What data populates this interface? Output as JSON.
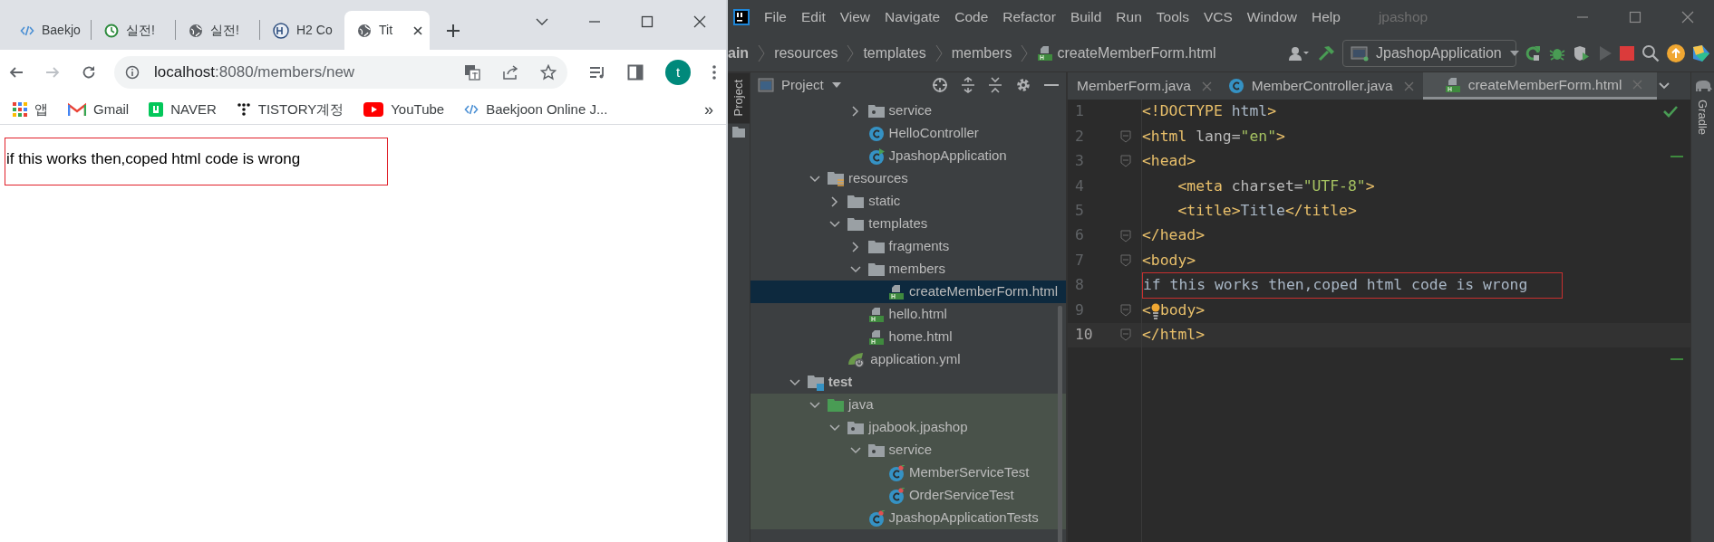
{
  "browser": {
    "tabs": [
      {
        "label": "Baekjo",
        "kind": "code",
        "selected": false
      },
      {
        "label": "실전!",
        "kind": "clock",
        "selected": false
      },
      {
        "label": "실전!",
        "kind": "globe",
        "selected": false
      },
      {
        "label": "H2 Co",
        "kind": "h2",
        "selected": false
      },
      {
        "label": "Tit",
        "kind": "globe",
        "selected": true
      }
    ],
    "nav_buttons": [
      {
        "kind": "back",
        "disabled": false
      },
      {
        "kind": "forward",
        "disabled": true
      },
      {
        "kind": "reload",
        "disabled": false
      }
    ],
    "address": {
      "host": "localhost",
      "path": ":8080/members/new"
    },
    "profile_initial": "t",
    "bookmarks": [
      {
        "label": "앱",
        "kind": "apps"
      },
      {
        "label": "Gmail",
        "kind": "mail"
      },
      {
        "label": "NAVER",
        "kind": "square"
      },
      {
        "label": "TISTORY계정",
        "kind": "dots"
      },
      {
        "label": "YouTube",
        "kind": "play"
      },
      {
        "label": "Baekjoon Online J...",
        "kind": "code"
      }
    ],
    "bookmarks_overflow": "»",
    "page_text": "if this works then,coped html code is wrong",
    "page_text_annotated": true
  },
  "ide": {
    "menu": [
      "File",
      "Edit",
      "View",
      "Navigate",
      "Code",
      "Refactor",
      "Build",
      "Run",
      "Tools",
      "VCS",
      "Window",
      "Help"
    ],
    "project_name": "jpashop",
    "breadcrumbs": [
      {
        "label": "ain",
        "kind": "folder"
      },
      {
        "label": "resources",
        "kind": "folder"
      },
      {
        "label": "templates",
        "kind": "folder"
      },
      {
        "label": "members",
        "kind": "folder"
      },
      {
        "label": "createMemberForm.html",
        "kind": "html"
      }
    ],
    "run_config": "JpashopApplication",
    "left_strip": "Project",
    "right_strip": "Gradle",
    "project_view": "Project",
    "tree": [
      {
        "children": [
          {
            "children": [
              {
                "children": [
                  {
                    "label": "service",
                    "kind": "package",
                    "expanded": false,
                    "selected": false
                  },
                  {
                    "label": "HelloController",
                    "kind": "class",
                    "selected": false
                  },
                  {
                    "label": "JpashopApplication",
                    "kind": "app_class",
                    "selected": false
                  }
                ]
              }
            ]
          },
          {
            "label": "resources",
            "kind": "resources_folder",
            "expanded": true,
            "selected": false,
            "children": [
              {
                "label": "static",
                "kind": "folder",
                "expanded": false,
                "selected": false
              },
              {
                "label": "templates",
                "kind": "folder",
                "expanded": true,
                "selected": false,
                "children": [
                  {
                    "label": "fragments",
                    "kind": "folder",
                    "expanded": false,
                    "selected": false
                  },
                  {
                    "label": "members",
                    "kind": "folder",
                    "expanded": true,
                    "selected": false,
                    "children": [
                      {
                        "label": "createMemberForm.html",
                        "kind": "html",
                        "selected": true
                      }
                    ]
                  },
                  {
                    "label": "hello.html",
                    "kind": "html",
                    "selected": false
                  },
                  {
                    "label": "home.html",
                    "kind": "html",
                    "selected": false
                  }
                ]
              },
              {
                "label": "application.yml",
                "kind": "yml",
                "selected": false
              }
            ]
          }
        ]
      },
      {
        "label": "test",
        "kind": "test_root",
        "expanded": true,
        "selected": false,
        "children": [
          {
            "label": "java",
            "kind": "source_folder",
            "expanded": true,
            "selected": false,
            "children": [
              {
                "label": "jpabook.jpashop",
                "kind": "package",
                "expanded": true,
                "selected": false,
                "children": [
                  {
                    "label": "service",
                    "kind": "package",
                    "expanded": true,
                    "selected": false,
                    "children": [
                      {
                        "label": "MemberServiceTest",
                        "kind": "test_class",
                        "selected": false
                      },
                      {
                        "label": "OrderServiceTest",
                        "kind": "test_class",
                        "selected": false
                      }
                    ]
                  },
                  {
                    "label": "JpashopApplicationTests",
                    "kind": "test_class",
                    "selected": false
                  }
                ]
              }
            ]
          }
        ]
      }
    ],
    "editor_tabs": [
      {
        "label": "MemberForm.java",
        "kind": "plain",
        "selected": false
      },
      {
        "label": "MemberController.java",
        "kind": "class",
        "selected": false
      },
      {
        "label": "createMemberForm.html",
        "kind": "html",
        "selected": true
      }
    ],
    "lines": [
      {
        "number": "1",
        "fold": false,
        "current": false,
        "tokens": [
          {
            "kind": "tag",
            "text": "<!DOCTYPE"
          },
          {
            "kind": "text",
            "text": " html"
          },
          {
            "kind": "tag",
            "text": ">"
          }
        ]
      },
      {
        "number": "2",
        "fold": true,
        "current": false,
        "tokens": [
          {
            "kind": "tag",
            "text": "<html"
          },
          {
            "kind": "attr",
            "text": " lang="
          },
          {
            "kind": "string",
            "text": "\"en\""
          },
          {
            "kind": "tag",
            "text": ">"
          }
        ]
      },
      {
        "number": "3",
        "fold": true,
        "current": false,
        "tokens": [
          {
            "kind": "tag",
            "text": "<head>"
          }
        ]
      },
      {
        "number": "4",
        "fold": false,
        "current": false,
        "tokens": [
          {
            "kind": "tag",
            "text": "    <meta"
          },
          {
            "kind": "attr",
            "text": " charset="
          },
          {
            "kind": "string",
            "text": "\"UTF-8\""
          },
          {
            "kind": "tag",
            "text": ">"
          }
        ]
      },
      {
        "number": "5",
        "fold": false,
        "current": false,
        "tokens": [
          {
            "kind": "tag",
            "text": "    <title>"
          },
          {
            "kind": "text",
            "text": "Title"
          },
          {
            "kind": "tag",
            "text": "</title>"
          }
        ]
      },
      {
        "number": "6",
        "fold": true,
        "current": false,
        "tokens": [
          {
            "kind": "tag",
            "text": "</head>"
          }
        ]
      },
      {
        "number": "7",
        "fold": true,
        "current": false,
        "tokens": [
          {
            "kind": "tag",
            "text": "<body>"
          }
        ]
      },
      {
        "number": "8",
        "fold": false,
        "current": false,
        "annotated": true,
        "tokens": [
          {
            "kind": "text",
            "text": "if this works then,coped html code is wrong"
          }
        ]
      },
      {
        "number": "9",
        "fold": true,
        "current": false,
        "tokens": [
          {
            "kind": "tag",
            "text": "<"
          },
          {
            "kind": "bulb"
          },
          {
            "kind": "tag",
            "text": "body>"
          }
        ]
      },
      {
        "number": "10",
        "fold": true,
        "current": true,
        "tokens": [
          {
            "kind": "tag",
            "text": "</html>"
          }
        ]
      }
    ]
  }
}
